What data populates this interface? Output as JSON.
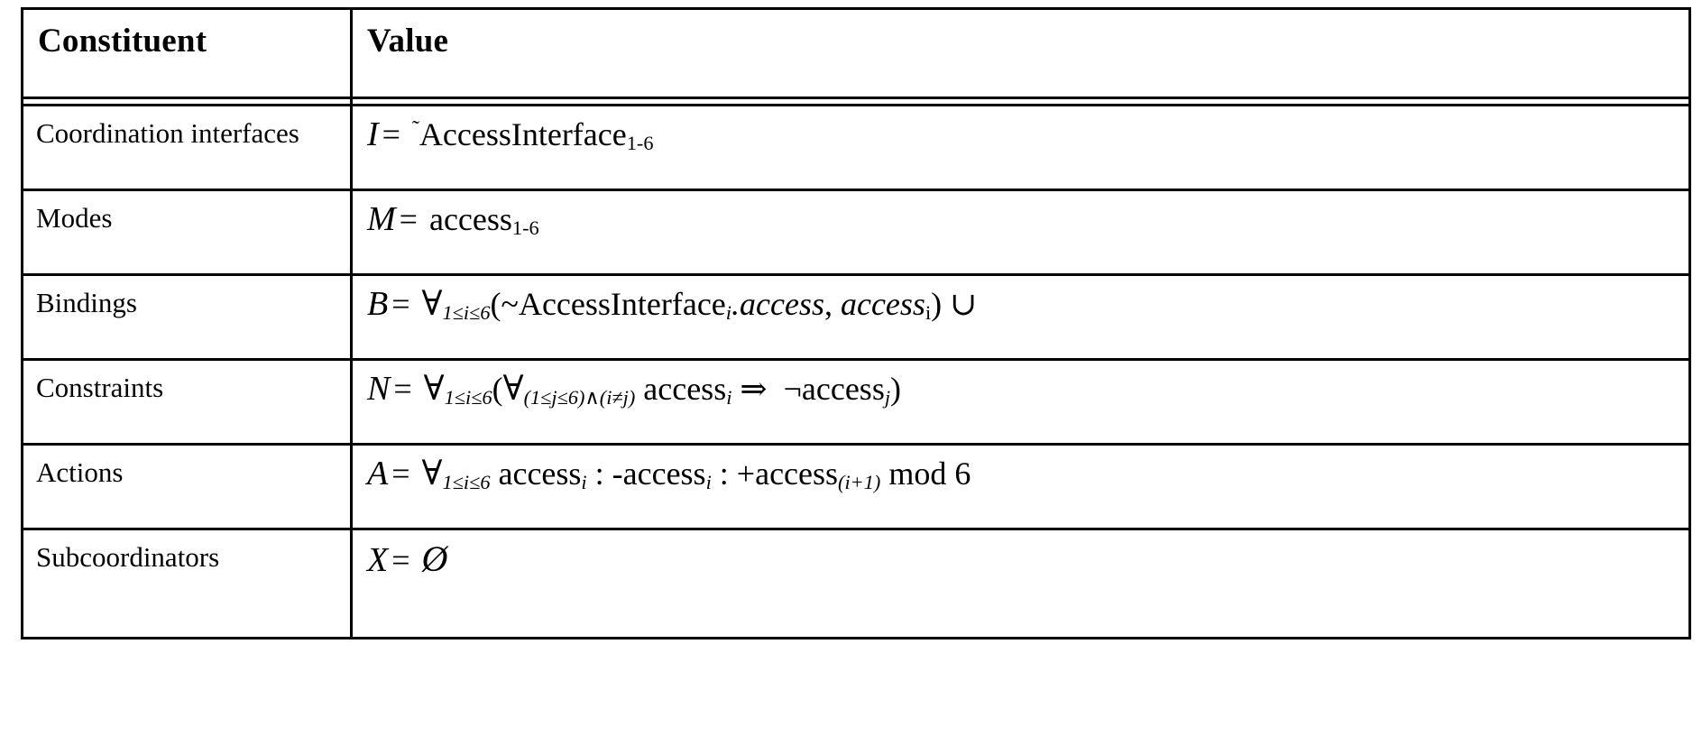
{
  "document": {
    "type": "scanned-table",
    "background_color": "#ffffff",
    "ink_color": "#000000"
  },
  "table": {
    "name": "coordinator-specification-table",
    "headers": {
      "constituent": "Constituent",
      "value": "Value"
    },
    "rows": [
      {
        "constituent": "Coordination interfaces",
        "value_plain": "I = ˜AccessInterface1-6",
        "value_parts": {
          "symbol": "I",
          "equals": "=",
          "tilde": "˜",
          "body": "AccessInterface",
          "subscript": "1-6"
        }
      },
      {
        "constituent": "Modes",
        "value_plain": "M = access1-6",
        "value_parts": {
          "symbol": "M",
          "equals": "=",
          "body": "access",
          "subscript": "1-6"
        }
      },
      {
        "constituent": "Bindings",
        "value_plain": "B = ∀1≤i≤6(~AccessInterfacei.access, accessi) ∪",
        "value_parts": {
          "symbol": "B",
          "equals": "=",
          "quantifier": "∀",
          "quant_subscript": "1≤i≤6",
          "open_paren": "(~",
          "body": "AccessInterface",
          "body_subscript": "i",
          "dot_access": ".access",
          "second": "access",
          "second_subscript": "i",
          "close_paren": ")",
          "union": "∪"
        }
      },
      {
        "constituent": "Constraints",
        "value_plain": "N = ∀1≤i≤6(∀(1≤j≤6)∧(i≠j) accessi ⇒ ¬accessj)",
        "value_parts": {
          "symbol": "N",
          "equals": "=",
          "quantifier": "∀",
          "quant_subscript": "1≤i≤6",
          "inner_quantifier": "∀",
          "inner_subscript": "(1≤j≤6)∧(i≠j)",
          "lhs": "access",
          "lhs_subscript": "i",
          "implies": "⇒",
          "negation": "¬",
          "rhs": "access",
          "rhs_subscript": "j",
          "close_paren": ")"
        }
      },
      {
        "constituent": "Actions",
        "value_plain": "A = ∀1≤i≤6 accessi : -accessi : +access(i+1) mod 6",
        "value_parts": {
          "symbol": "A",
          "equals": "=",
          "quantifier": "∀",
          "quant_subscript": "1≤i≤6",
          "guard": "access",
          "guard_subscript": "i",
          "colon_one": ":",
          "remove": "-access",
          "remove_subscript": "i",
          "colon_two": ":",
          "add": "+access",
          "add_subscript": "(i+1)",
          "modulo": "mod 6"
        }
      },
      {
        "constituent": "Subcoordinators",
        "value_plain": "X = Ø",
        "value_parts": {
          "symbol": "X",
          "equals": "=",
          "empty_set": "Ø"
        }
      }
    ]
  }
}
